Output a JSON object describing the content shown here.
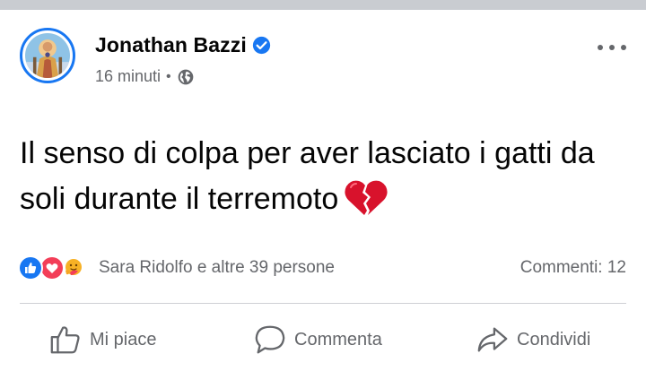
{
  "post": {
    "author": "Jonathan Bazzi",
    "time": "16 minuti",
    "separator": "•",
    "message": "Il senso di colpa per aver lasciato i gatti da soli durante il terremoto",
    "message_emoji": "broken-heart-icon"
  },
  "reactions": {
    "types": [
      "like-icon",
      "love-icon",
      "care-icon"
    ],
    "summary": "Sara Ridolfo e altre 39 persone"
  },
  "comments_label": "Commenti: 12",
  "actions": {
    "like": "Mi piace",
    "comment": "Commenta",
    "share": "Condividi"
  },
  "colors": {
    "accent": "#1877f2",
    "secondary_text": "#65676b",
    "love": "#f33e58",
    "care": "#f7b125"
  }
}
